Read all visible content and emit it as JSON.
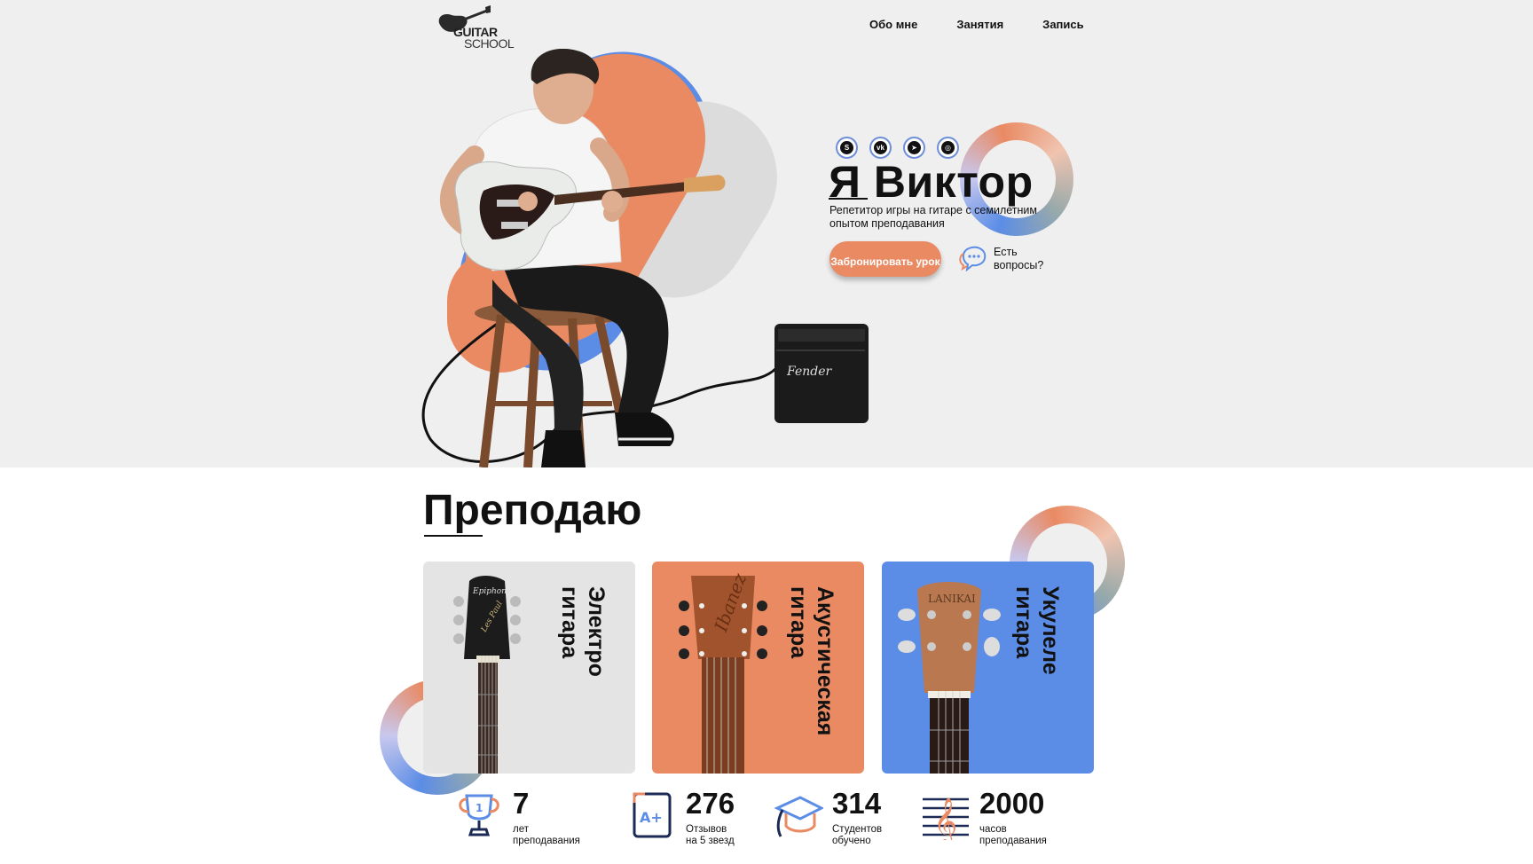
{
  "logo": {
    "line1": "GUITAR",
    "line2": "SCHOOL"
  },
  "nav": [
    {
      "label": "Обо мне"
    },
    {
      "label": "Занятия"
    },
    {
      "label": "Запись"
    }
  ],
  "socials": [
    {
      "icon": "skype-icon",
      "glyph": "S"
    },
    {
      "icon": "vk-icon",
      "glyph": "vk"
    },
    {
      "icon": "telegram-icon",
      "glyph": "➤"
    },
    {
      "icon": "instagram-icon",
      "glyph": "◎"
    }
  ],
  "hero": {
    "title": "Я Виктор",
    "subtitle": "Репетитор игры на гитаре с семилетним опытом преподавания",
    "book_button": "Забронировать урок",
    "questions": "Есть вопросы?"
  },
  "teach": {
    "title": "Преподаю",
    "cards": [
      {
        "label": "Электро\nгитара"
      },
      {
        "label": "Акустическая\nгитара"
      },
      {
        "label": "Укулеле\nгитара"
      }
    ]
  },
  "stats": [
    {
      "value": "7",
      "label": "лет\nпреподавания",
      "icon": "trophy-icon"
    },
    {
      "value": "276",
      "label": "Отзывов\nна 5 звезд",
      "icon": "grade-a-plus-icon"
    },
    {
      "value": "314",
      "label": "Студентов\nобучено",
      "icon": "graduation-cap-icon"
    },
    {
      "value": "2000",
      "label": "часов\nпреподавания",
      "icon": "music-clef-icon"
    }
  ],
  "colors": {
    "accent_orange": "#e98a63",
    "accent_blue": "#5b8de6",
    "hero_bg": "#efefef"
  }
}
